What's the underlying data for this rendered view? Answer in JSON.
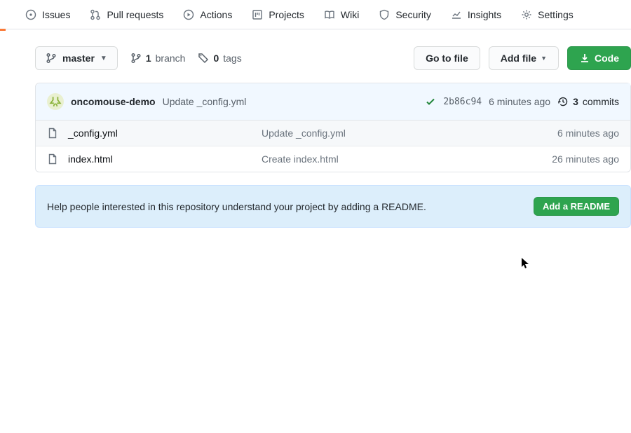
{
  "nav": {
    "issues": "Issues",
    "pulls": "Pull requests",
    "actions": "Actions",
    "projects": "Projects",
    "wiki": "Wiki",
    "security": "Security",
    "insights": "Insights",
    "settings": "Settings"
  },
  "branch": {
    "name": "master",
    "branch_count": "1",
    "branch_label": "branch",
    "tag_count": "0",
    "tag_label": "tags"
  },
  "actionsbar": {
    "go_to_file": "Go to file",
    "add_file": "Add file",
    "code": "Code"
  },
  "latest_commit": {
    "author": "oncomouse-demo",
    "message": "Update _config.yml",
    "sha": "2b86c94",
    "time": "6 minutes ago",
    "commits_count": "3",
    "commits_label": "commits"
  },
  "files": [
    {
      "name": "_config.yml",
      "msg": "Update _config.yml",
      "time": "6 minutes ago"
    },
    {
      "name": "index.html",
      "msg": "Create index.html",
      "time": "26 minutes ago"
    }
  ],
  "readme": {
    "prompt": "Help people interested in this repository understand your project by adding a README.",
    "button": "Add a README"
  }
}
